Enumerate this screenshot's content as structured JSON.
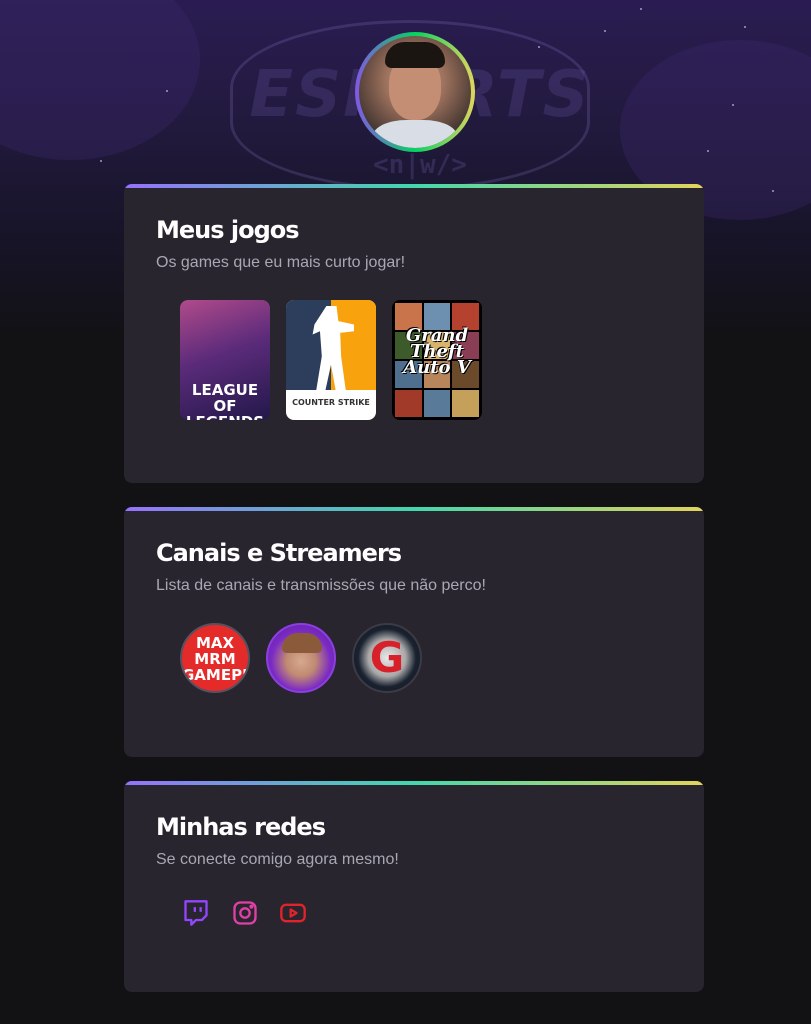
{
  "profile": {
    "avatar_icon": "profile-photo"
  },
  "background": {
    "watermark_text": "ESPORTS",
    "watermark_sub": "<n|w/>"
  },
  "cards": {
    "games": {
      "title": "Meus jogos",
      "subtitle": "Os games que eu mais curto jogar!",
      "items": [
        {
          "name": "League of Legends",
          "cover_text": "LEAGUE OF LEGENDS"
        },
        {
          "name": "Counter Strike",
          "cover_text": "COUNTER STRIKE"
        },
        {
          "name": "Grand Theft Auto V",
          "cover_text": "Grand Theft Auto V"
        }
      ]
    },
    "channels": {
      "title": "Canais e Streamers",
      "subtitle": "Lista de canais e transmissões que não perco!",
      "items": [
        {
          "avatar_text": "MAX MRM GAMEPLAYS"
        },
        {
          "avatar_text": ""
        },
        {
          "avatar_text": "G"
        }
      ]
    },
    "social": {
      "title": "Minhas redes",
      "subtitle": "Se conecte comigo agora mesmo!",
      "items": [
        {
          "icon": "twitch-icon",
          "color": "#9146ff"
        },
        {
          "icon": "instagram-icon",
          "color": "#e040a6"
        },
        {
          "icon": "youtube-icon",
          "color": "#e0242a"
        }
      ]
    }
  },
  "colors": {
    "background": "#121214",
    "card": "#29252f",
    "accent_gradient": [
      "#9572fc",
      "#43d7ad",
      "#e2d45c"
    ],
    "title": "#ffffff",
    "subtitle": "#a8a8b3"
  }
}
